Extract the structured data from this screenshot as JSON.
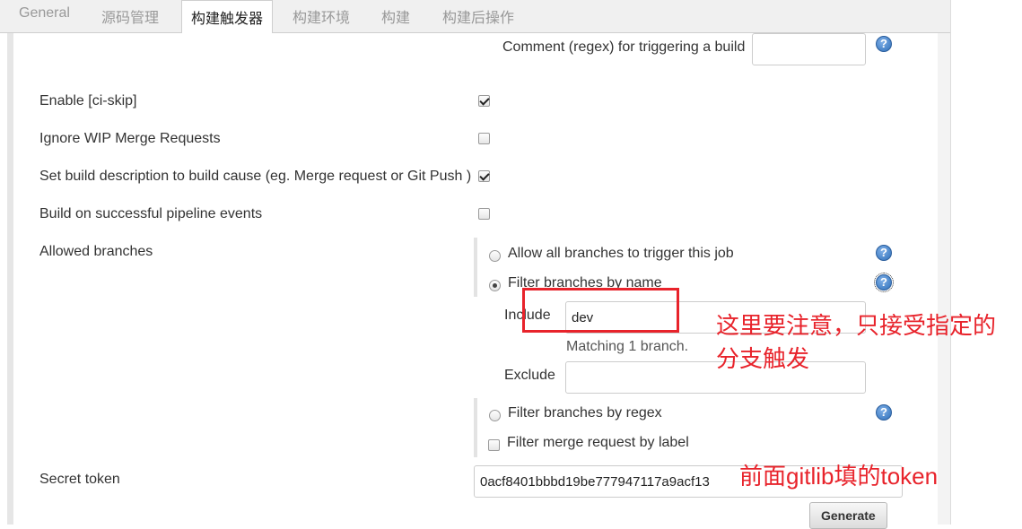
{
  "tabs": [
    "General",
    "源码管理",
    "构建触发器",
    "构建环境",
    "构建",
    "构建后操作"
  ],
  "active_tab": "构建触发器",
  "comment_regex": {
    "label": "Comment (regex) for triggering a build",
    "value": ""
  },
  "options": [
    {
      "label": "Enable [ci-skip]",
      "checked": true
    },
    {
      "label": "Ignore WIP Merge Requests",
      "checked": false
    },
    {
      "label": "Set build description to build cause (eg. Merge request or Git Push )",
      "checked": true
    },
    {
      "label": "Build on successful pipeline events",
      "checked": false
    }
  ],
  "allowed_branches": {
    "label": "Allowed branches",
    "choices": [
      {
        "label": "Allow all branches to trigger this job",
        "selected": false
      },
      {
        "label": "Filter branches by name",
        "selected": true
      }
    ],
    "include": {
      "label": "Include",
      "value": "dev"
    },
    "matching_text": "Matching 1 branch.",
    "exclude": {
      "label": "Exclude",
      "value": ""
    },
    "regex_choice": {
      "label": "Filter branches by regex",
      "selected": false
    },
    "merge_label": {
      "label": "Filter merge request by label",
      "checked": false
    }
  },
  "secret_token": {
    "label": "Secret token",
    "value": "0acf8401bbbd19be777947117a9acf13"
  },
  "generate_label": "Generate",
  "help_glyph": "?",
  "annotations": {
    "include_note_line1": "这里要注意，只接受指定的",
    "include_note_line2": "分支触发",
    "token_note": "前面gitlib填的token",
    "color": "#e8232b"
  }
}
